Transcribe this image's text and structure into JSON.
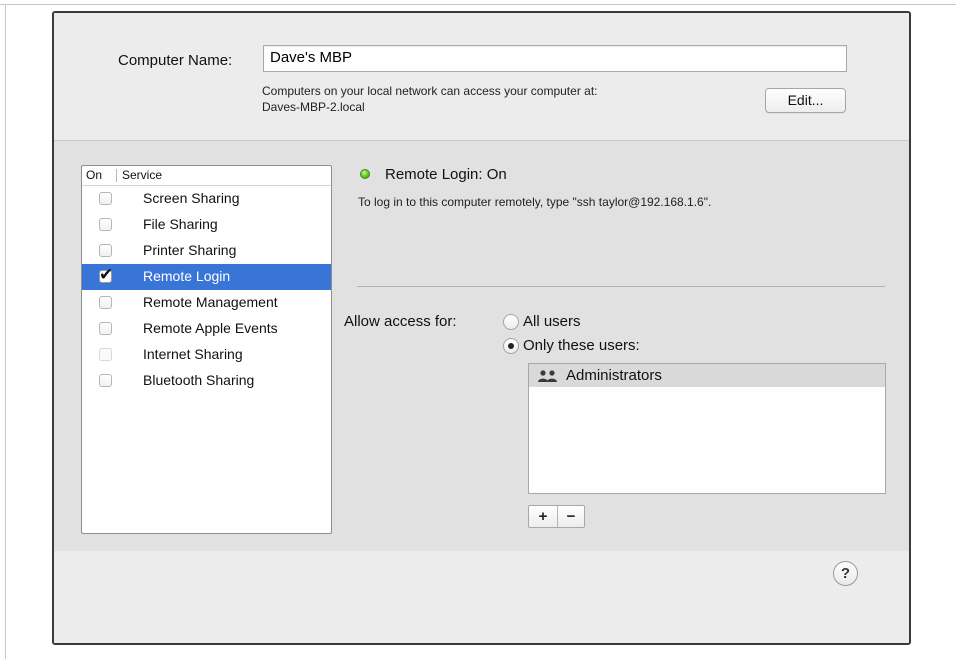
{
  "computer_name": {
    "label": "Computer Name:",
    "value": "Dave's MBP",
    "description_line1": "Computers on your local network can access your computer at:",
    "description_line2": "Daves-MBP-2.local",
    "edit_button": "Edit..."
  },
  "services": {
    "header_on": "On",
    "header_service": "Service",
    "items": [
      {
        "label": "Screen Sharing",
        "checked": false,
        "selected": false,
        "enabled": true
      },
      {
        "label": "File Sharing",
        "checked": false,
        "selected": false,
        "enabled": true
      },
      {
        "label": "Printer Sharing",
        "checked": false,
        "selected": false,
        "enabled": true
      },
      {
        "label": "Remote Login",
        "checked": true,
        "selected": true,
        "enabled": true
      },
      {
        "label": "Remote Management",
        "checked": false,
        "selected": false,
        "enabled": true
      },
      {
        "label": "Remote Apple Events",
        "checked": false,
        "selected": false,
        "enabled": true
      },
      {
        "label": "Internet Sharing",
        "checked": false,
        "selected": false,
        "enabled": false
      },
      {
        "label": "Bluetooth Sharing",
        "checked": false,
        "selected": false,
        "enabled": true
      }
    ]
  },
  "status": {
    "title": "Remote Login: On",
    "description": "To log in to this computer remotely, type \"ssh taylor@192.168.1.6\".",
    "indicator_color": "#5bbf1f"
  },
  "access": {
    "label": "Allow access for:",
    "option_all": "All users",
    "option_only": "Only these users:",
    "selected_option": "only",
    "users": [
      {
        "label": "Administrators",
        "icon": "group-icon"
      }
    ],
    "add_label": "+",
    "remove_label": "−"
  },
  "help_label": "?",
  "colors": {
    "selection": "#3875d7",
    "panel_background": "#e1e1e1",
    "window_background": "#ececec"
  }
}
